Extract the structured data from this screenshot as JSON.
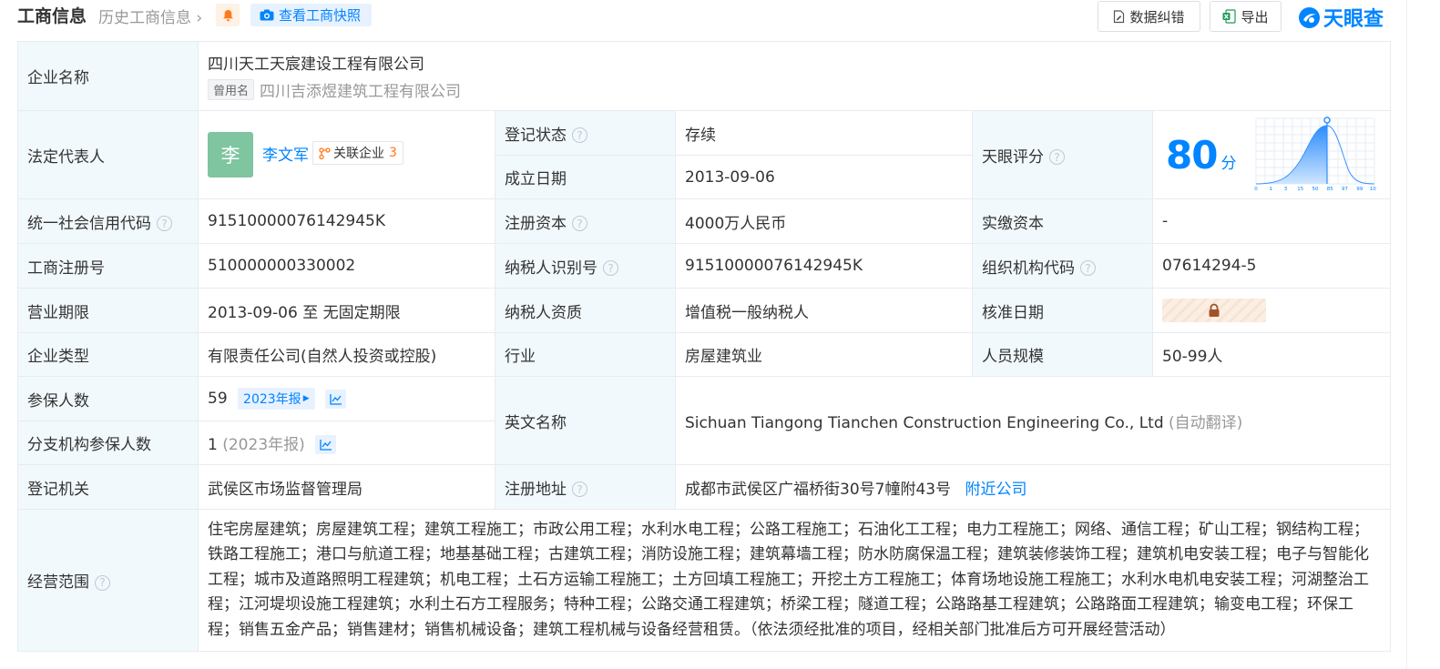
{
  "header": {
    "title": "工商信息",
    "history": "历史工商信息",
    "snapshot_btn": "查看工商快照",
    "correct_btn": "数据纠错",
    "export_btn": "导出",
    "logo_text": "天眼查"
  },
  "company": {
    "name_label": "企业名称",
    "name": "四川天工天宸建设工程有限公司",
    "former_tag": "曾用名",
    "former_name": "四川吉添煜建筑工程有限公司"
  },
  "legal": {
    "label": "法定代表人",
    "avatar_char": "李",
    "name": "李文军",
    "related_label": "关联企业",
    "related_count": "3"
  },
  "status": {
    "label": "登记状态",
    "value": "存续"
  },
  "founded": {
    "label": "成立日期",
    "value": "2013-09-06"
  },
  "score": {
    "label": "天眼评分",
    "value": "80",
    "unit": "分",
    "x_ticks": [
      "0",
      "1",
      "3",
      "15",
      "50",
      "85",
      "97",
      "99",
      "100"
    ]
  },
  "credit_code": {
    "label": "统一社会信用代码",
    "value": "91510000076142945K"
  },
  "reg_capital": {
    "label": "注册资本",
    "value": "4000万人民币"
  },
  "paid_capital": {
    "label": "实缴资本",
    "value": "-"
  },
  "reg_no": {
    "label": "工商注册号",
    "value": "510000000330002"
  },
  "taxpayer_id": {
    "label": "纳税人识别号",
    "value": "91510000076142945K"
  },
  "org_code": {
    "label": "组织机构代码",
    "value": "07614294-5"
  },
  "term": {
    "label": "营业期限",
    "value": "2013-09-06 至 无固定期限"
  },
  "taxpayer_qual": {
    "label": "纳税人资质",
    "value": "增值税一般纳税人"
  },
  "approve_date": {
    "label": "核准日期"
  },
  "company_type": {
    "label": "企业类型",
    "value": "有限责任公司(自然人投资或控股)"
  },
  "industry": {
    "label": "行业",
    "value": "房屋建筑业"
  },
  "staff_size": {
    "label": "人员规模",
    "value": "50-99人"
  },
  "insured": {
    "label": "参保人数",
    "value": "59",
    "report_tag": "2023年报"
  },
  "branch_insured": {
    "label": "分支机构参保人数",
    "value": "1",
    "report": "(2023年报)"
  },
  "english_name": {
    "label": "英文名称",
    "value": "Sichuan Tiangong Tianchen Construction Engineering Co., Ltd",
    "note": "(自动翻译)"
  },
  "reg_authority": {
    "label": "登记机关",
    "value": "武侯区市场监督管理局"
  },
  "reg_address": {
    "label": "注册地址",
    "value": "成都市武侯区广福桥街30号7幢附43号",
    "link": "附近公司"
  },
  "scope": {
    "label": "经营范围",
    "value": "住宅房屋建筑；房屋建筑工程；建筑工程施工；市政公用工程；水利水电工程；公路工程施工；石油化工工程；电力工程施工；网络、通信工程；矿山工程；钢结构工程；铁路工程施工；港口与航道工程；地基基础工程；古建筑工程；消防设施工程；建筑幕墙工程；防水防腐保温工程；建筑装修装饰工程；建筑机电安装工程；电子与智能化工程；城市及道路照明工程建筑；机电工程；土石方运输工程施工；土方回填工程施工；开挖土方工程施工；体育场地设施工程施工；水利水电机电安装工程；河湖整治工程；江河堤坝设施工程建筑；水利土石方工程服务；特种工程；公路交通工程建筑；桥梁工程；隧道工程；公路路基工程建筑；公路路面工程建筑；输变电工程；环保工程；销售五金产品；销售建材；销售机械设备；建筑工程机械与设备经营租赁。（依法须经批准的项目，经相关部门批准后方可开展经营活动）"
  },
  "colors": {
    "accent": "#0084ff",
    "label_bg": "#f2f9fc",
    "status_green": "#22a056",
    "count_orange": "#ff7a1a"
  }
}
